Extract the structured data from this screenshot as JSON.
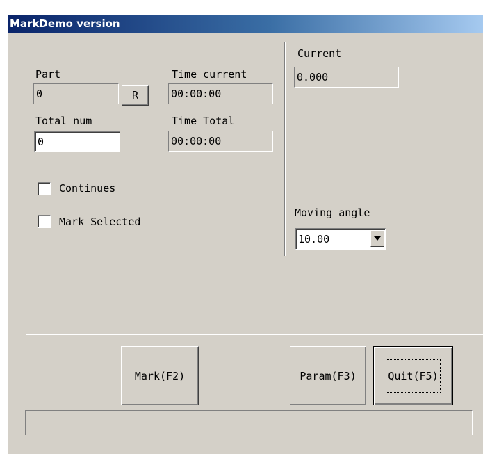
{
  "window": {
    "title": "MarkDemo version"
  },
  "left_panel": {
    "part": {
      "label": "Part",
      "value": "0",
      "reset_button": "R"
    },
    "time_current": {
      "label": "Time current",
      "value": "00:00:00"
    },
    "total_num": {
      "label": "Total num",
      "value": "0"
    },
    "time_total": {
      "label": "Time Total",
      "value": "00:00:00"
    },
    "continues": {
      "label": "Continues",
      "checked": false
    },
    "mark_selected": {
      "label": "Mark Selected",
      "checked": false
    }
  },
  "right_panel": {
    "current": {
      "label": "Current",
      "value": "0.000"
    },
    "moving_angle": {
      "label": "Moving angle",
      "value": "10.00"
    }
  },
  "buttons": {
    "mark": "Mark(F2)",
    "param": "Param(F3)",
    "quit": "Quit(F5)"
  },
  "status_bar": {
    "text": ""
  },
  "icons": {
    "dropdown": "chevron-down-icon"
  }
}
